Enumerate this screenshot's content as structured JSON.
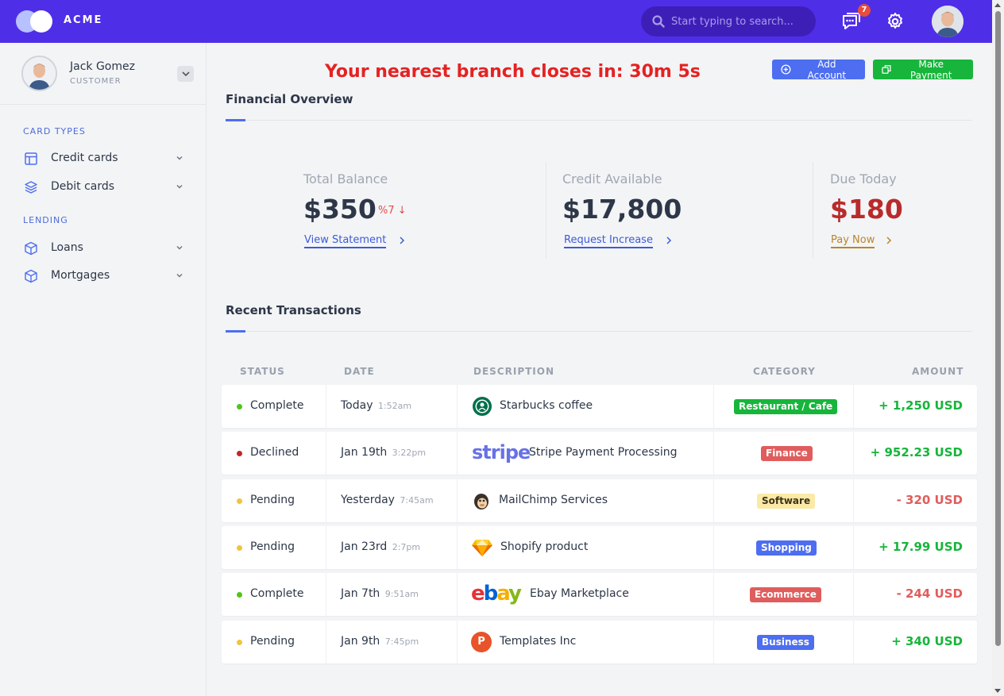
{
  "header": {
    "brand": "ACME",
    "search_placeholder": "Start typing to search...",
    "notifications_count": "7",
    "colors": {
      "bar": "#4f2ee8",
      "badge": "#e74c3c"
    }
  },
  "profile": {
    "name": "Jack Gomez",
    "role": "CUSTOMER"
  },
  "sidebar": {
    "sections": [
      {
        "label": "CARD TYPES",
        "items": [
          {
            "label": "Credit cards",
            "icon": "card-icon"
          },
          {
            "label": "Debit cards",
            "icon": "layers-icon"
          }
        ]
      },
      {
        "label": "LENDING",
        "items": [
          {
            "label": "Loans",
            "icon": "box-icon"
          },
          {
            "label": "Mortgages",
            "icon": "box-icon"
          }
        ]
      }
    ]
  },
  "main": {
    "countdown": "Your nearest branch closes in: 30m 5s",
    "add_account_label": "Add Account",
    "make_payment_label": "Make Payment",
    "financial_overview_title": "Financial Overview",
    "stats": {
      "total_balance": {
        "label": "Total Balance",
        "value": "$350",
        "trend": "%7",
        "link": "View Statement"
      },
      "credit_available": {
        "label": "Credit Available",
        "value": "$17,800",
        "link": "Request Increase"
      },
      "due_today": {
        "label": "Due Today",
        "value": "$180",
        "link": "Pay Now"
      }
    },
    "recent_transactions_title": "Recent Transactions",
    "table": {
      "headers": {
        "status": "STATUS",
        "date": "DATE",
        "description": "DESCRIPTION",
        "category": "CATEGORY",
        "amount": "AMOUNT"
      },
      "rows": [
        {
          "status": "Complete",
          "status_color": "#52c41a",
          "date": "Today",
          "time": "1:52am",
          "logo": "starbucks-logo",
          "description": "Starbucks coffee",
          "category": "Restaurant / Cafe",
          "category_color": "#17b53b",
          "amount": "+ 1,250 USD",
          "amount_color": "#17b53b"
        },
        {
          "status": "Declined",
          "status_color": "#c0262b",
          "date": "Jan 19th",
          "time": "3:22pm",
          "logo": "stripe-logo",
          "logo_text": "stripe",
          "description": "Stripe Payment Processing",
          "category": "Finance",
          "category_color": "#e05d5d",
          "amount": "+ 952.23 USD",
          "amount_color": "#17b53b"
        },
        {
          "status": "Pending",
          "status_color": "#f0c43c",
          "date": "Yesterday",
          "time": "7:45am",
          "logo": "mailchimp-logo",
          "description": "MailChimp Services",
          "category": "Software",
          "category_color": "#fbe9a6",
          "amount": "- 320 USD",
          "amount_color": "#e05d5d"
        },
        {
          "status": "Pending",
          "status_color": "#f0c43c",
          "date": "Jan 23rd",
          "time": "2:7pm",
          "logo": "sketch-logo",
          "description": "Shopify product",
          "category": "Shopping",
          "category_color": "#4d6ef0",
          "amount": "+ 17.99 USD",
          "amount_color": "#17b53b"
        },
        {
          "status": "Complete",
          "status_color": "#52c41a",
          "date": "Jan 7th",
          "time": "9:51am",
          "logo": "ebay-logo",
          "description": "Ebay Marketplace",
          "category": "Ecommerce",
          "category_color": "#e05d5d",
          "amount": "- 244 USD",
          "amount_color": "#e05d5d"
        },
        {
          "status": "Pending",
          "status_color": "#f0c43c",
          "date": "Jan 9th",
          "time": "7:45pm",
          "logo": "templates-logo",
          "logo_text": "P",
          "description": "Templates Inc",
          "category": "Business",
          "category_color": "#4d6ef0",
          "amount": "+ 340 USD",
          "amount_color": "#17b53b"
        }
      ]
    }
  }
}
